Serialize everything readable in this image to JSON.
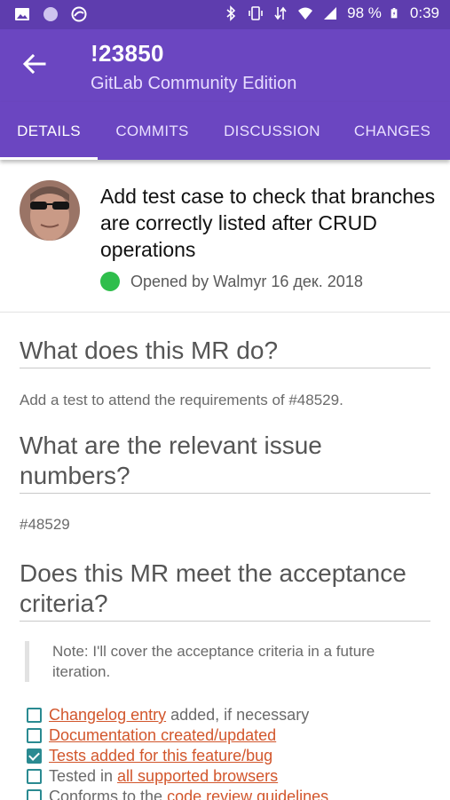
{
  "status_bar": {
    "battery": "98 %",
    "time": "0:39",
    "icons": [
      "image-icon",
      "circle-icon",
      "globe-icon",
      "bluetooth-icon",
      "vibrate-icon",
      "data-arrows-icon",
      "wifi-icon",
      "signal-icon",
      "battery-charging-icon"
    ]
  },
  "toolbar": {
    "title": "!23850",
    "subtitle": "GitLab Community Edition"
  },
  "tabs": [
    {
      "label": "DETAILS",
      "active": true
    },
    {
      "label": "COMMITS",
      "active": false
    },
    {
      "label": "DISCUSSION",
      "active": false
    },
    {
      "label": "CHANGES",
      "active": false
    }
  ],
  "merge_request": {
    "title": "Add test case to check that branches are correctly listed after CRUD operations",
    "opened": "Opened by Walmyr 16 дек. 2018",
    "status_color": "#2fbe4c"
  },
  "description": {
    "h1": "What does this MR do?",
    "p1": "Add a test to attend the requirements of #48529.",
    "h2": "What are the relevant issue numbers?",
    "p2": "#48529",
    "h3": "Does this MR meet the acceptance criteria?",
    "note": "Note: I'll cover the acceptance criteria in a future iteration.",
    "tasks": [
      {
        "pre": "",
        "link": "Changelog entry",
        "post": " added, if necessary",
        "checked": false
      },
      {
        "pre": "",
        "link": "Documentation created/updated",
        "post": "",
        "checked": false
      },
      {
        "pre": "",
        "link": "Tests added for this feature/bug",
        "post": "",
        "checked": true
      },
      {
        "pre": "Tested in ",
        "link": "all supported browsers",
        "post": "",
        "checked": false
      },
      {
        "pre": "Conforms to the ",
        "link": "code review guidelines",
        "post": "",
        "checked": false
      }
    ]
  },
  "colors": {
    "primary": "#6b46c1",
    "status_bar": "#5e3dae",
    "link": "#d2562c",
    "checkbox": "#2a8a91"
  }
}
